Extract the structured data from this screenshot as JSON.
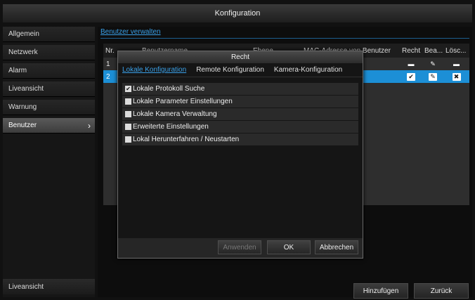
{
  "window": {
    "title": "Konfiguration"
  },
  "sidebar": {
    "items": [
      {
        "label": "Allgemein"
      },
      {
        "label": "Netzwerk"
      },
      {
        "label": "Alarm"
      },
      {
        "label": "Liveansicht"
      },
      {
        "label": "Warnung"
      },
      {
        "label": "Benutzer",
        "active": true,
        "chevron": "›"
      }
    ],
    "bottom_label": "Liveansicht"
  },
  "content": {
    "tab_label": "Benutzer verwalten",
    "table": {
      "columns": [
        "Nr.",
        "Benutzername",
        "Ebene",
        "MAC-Adresse von Benutzer",
        "Recht",
        "Bea...",
        "Lösc..."
      ],
      "rows": [
        {
          "nr": "1",
          "recht_icon": "minus-icon",
          "bea_icon": "pencil-icon",
          "loesch_icon": "minus-icon"
        },
        {
          "nr": "2",
          "recht_icon": "check-icon",
          "bea_icon": "pencil-icon",
          "loesch_icon": "delete-x-icon",
          "selected": true
        }
      ]
    },
    "buttons": {
      "add": "Hinzufügen",
      "back": "Zurück"
    }
  },
  "modal": {
    "title": "Recht",
    "tabs": [
      {
        "label": "Lokale Konfiguration",
        "active": true
      },
      {
        "label": "Remote Konfiguration"
      },
      {
        "label": "Kamera-Konfiguration"
      }
    ],
    "permissions": [
      {
        "label": "Lokale Protokoll Suche",
        "checked": true
      },
      {
        "label": "Lokale Parameter Einstellungen",
        "checked": false
      },
      {
        "label": "Lokale Kamera Verwaltung",
        "checked": false
      },
      {
        "label": "Erweiterte Einstellungen",
        "checked": false
      },
      {
        "label": "Lokal Herunterfahren / Neustarten",
        "checked": false
      }
    ],
    "buttons": {
      "apply": "Anwenden",
      "ok": "OK",
      "cancel": "Abbrechen"
    }
  },
  "colors": {
    "accent": "#1c8fd6",
    "link": "#3aa0e8"
  }
}
